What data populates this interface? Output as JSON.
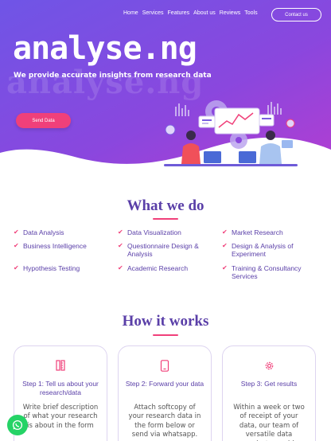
{
  "nav": {
    "items": [
      "Home",
      "Services",
      "Features",
      "About us",
      "Reviews",
      "Tools"
    ],
    "contact_label": "Contact us"
  },
  "hero": {
    "brand": "analyse.ng",
    "brand_shadow": "analyse.ng",
    "tagline": "We provide accurate insights from research data",
    "cta_label": "Send Data"
  },
  "what_we_do": {
    "title": "What we do",
    "services": [
      "Data Analysis",
      "Data Visualization",
      "Market Research",
      "Business Intelligence",
      "Questionnaire Design & Analysis",
      "Design & Analysis of Experiment",
      "Hypothesis Testing",
      "Academic Research",
      "Training & Consultancy Services"
    ]
  },
  "how_it_works": {
    "title": "How it works",
    "steps": [
      {
        "title": "Step 1: Tell us about your research/data",
        "desc": "Write brief description of what your research is about in the form",
        "icon": "pen-ruler-icon"
      },
      {
        "title": "Step 2: Forward your data",
        "desc": "Attach softcopy of your research data in the form below or send via whatsapp.",
        "icon": "phone-icon"
      },
      {
        "title": "Step 3: Get results",
        "desc": "Within a week or two of receipt of your data, our team of versatile data analysts would",
        "icon": "gear-icon"
      }
    ]
  },
  "colors": {
    "hero_gradient_start": "#7b4be0",
    "hero_gradient_end": "#a040d8",
    "accent": "#f0407a",
    "heading": "#5a3fa8",
    "whatsapp": "#25d366"
  }
}
